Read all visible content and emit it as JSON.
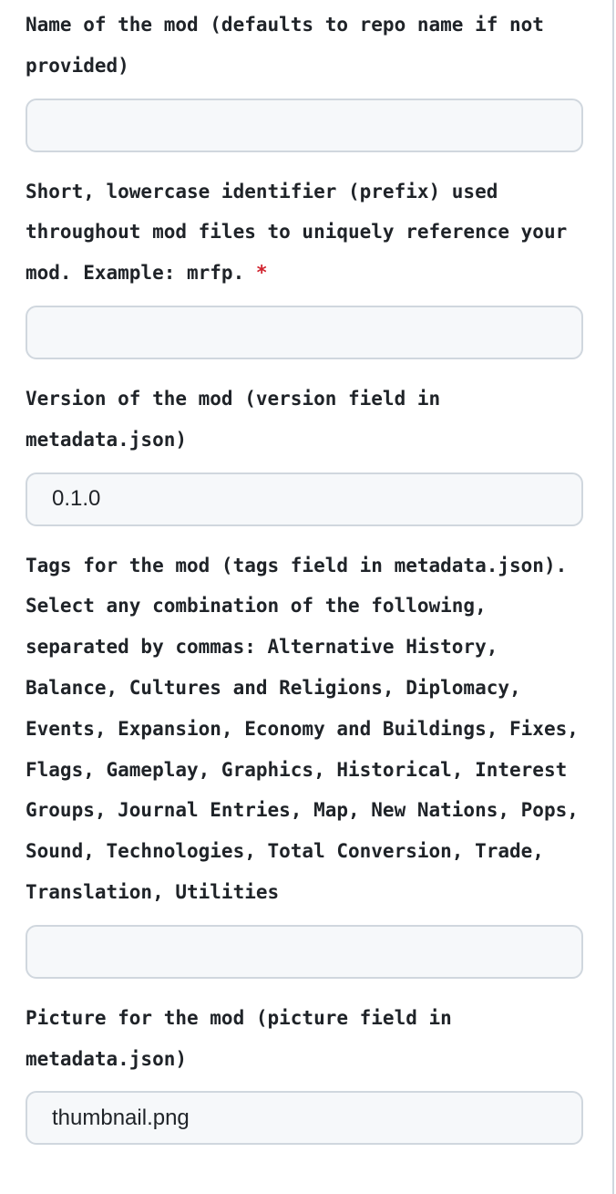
{
  "fields": [
    {
      "label": "Name of the mod (defaults to repo name if not provided)",
      "required": false,
      "value": ""
    },
    {
      "label": "Short, lowercase identifier (prefix) used throughout mod files to uniquely reference your mod. Example: mrfp. ",
      "required": true,
      "required_mark": "*",
      "value": ""
    },
    {
      "label": "Version of the mod (version field in metadata.json)",
      "required": false,
      "value": "0.1.0"
    },
    {
      "label": "Tags for the mod (tags field in metadata.json). Select any combination of the following, separated by commas: Alternative History, Balance, Cultures and Religions, Diplomacy, Events, Expansion, Economy and Buildings, Fixes, Flags, Gameplay, Graphics, Historical, Interest Groups, Journal Entries, Map, New Nations, Pops, Sound, Technologies, Total Conversion, Trade, Translation, Utilities",
      "required": false,
      "value": ""
    },
    {
      "label": "Picture for the mod (picture field in metadata.json)",
      "required": false,
      "value": "thumbnail.png"
    }
  ]
}
